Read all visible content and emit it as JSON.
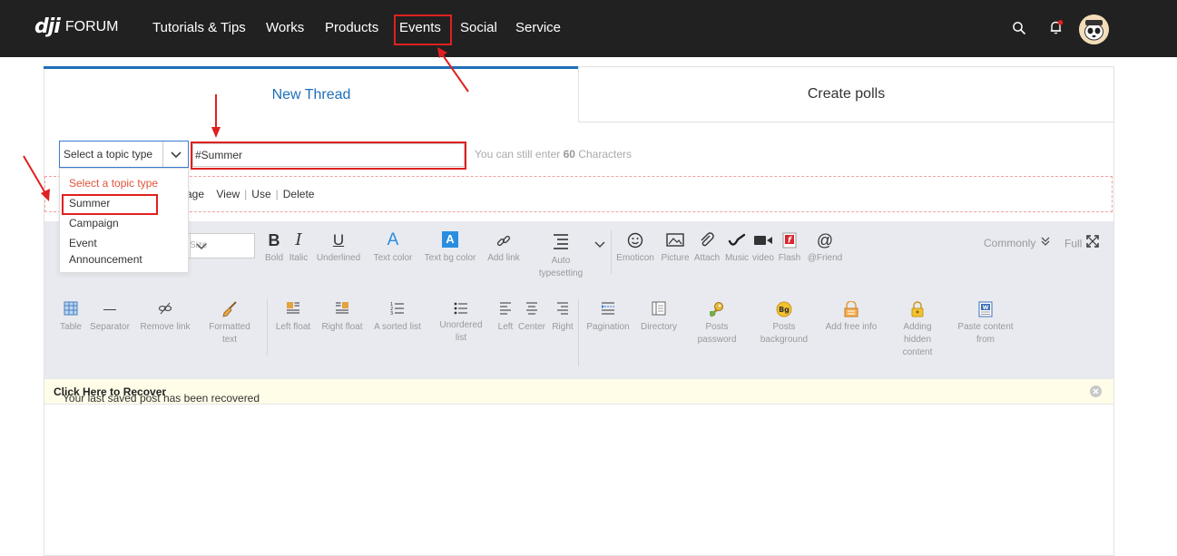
{
  "header": {
    "logo_mark": "dji",
    "logo_text": "FORUM",
    "nav": [
      "Tutorials & Tips",
      "Works",
      "Products",
      "Events",
      "Social",
      "Service"
    ],
    "search_icon": "search-icon",
    "bell_icon": "bell-icon",
    "notification_dot_color": "#e02020"
  },
  "tabs": {
    "new_thread": "New Thread",
    "create_polls": "Create polls"
  },
  "form": {
    "topic_select_value": "Select a topic type",
    "title_value": "#Summer",
    "char_hint_prefix": "You can still enter ",
    "char_hint_count": "60",
    "char_hint_suffix": " Characters",
    "tag_actions": [
      "age",
      "View",
      "Use",
      "Delete"
    ]
  },
  "dropdown": {
    "options": [
      "Select a topic type",
      "Summer",
      "Campaign",
      "Event",
      "Announcement"
    ]
  },
  "toolbar": {
    "size_placeholder": "Size",
    "row1": [
      {
        "icon": "bold-icon",
        "glyph": "B",
        "label": "Bold"
      },
      {
        "icon": "italic-icon",
        "glyph": "I",
        "label": "Italic"
      },
      {
        "icon": "underline-icon",
        "glyph": "U",
        "label": "Underlined"
      },
      {
        "icon": "text-color-icon",
        "glyph": "A",
        "label": "Text color"
      },
      {
        "icon": "text-bg-color-icon",
        "glyph": "A",
        "label": "Text bg color"
      },
      {
        "icon": "link-icon",
        "glyph": "🔗",
        "label": "Add link"
      },
      {
        "icon": "auto-typesetting-icon",
        "glyph": "≡",
        "label": "Auto typesetting"
      },
      {
        "icon": "emoticon-icon",
        "glyph": "☺",
        "label": "Emoticon"
      },
      {
        "icon": "picture-icon",
        "glyph": "▣",
        "label": "Picture"
      },
      {
        "icon": "attach-icon",
        "glyph": "📎",
        "label": "Attach"
      },
      {
        "icon": "music-icon",
        "glyph": "♪",
        "label": "Music"
      },
      {
        "icon": "video-icon",
        "glyph": "■",
        "label": "video"
      },
      {
        "icon": "flash-icon",
        "glyph": "f",
        "label": "Flash"
      },
      {
        "icon": "at-friend-icon",
        "glyph": "@",
        "label": "@Friend"
      }
    ],
    "commonly": "Commonly",
    "full": "Full",
    "row2": [
      {
        "icon": "table-icon",
        "glyph": "▦",
        "label": "Table"
      },
      {
        "icon": "separator-icon",
        "glyph": "—",
        "label": "Separator"
      },
      {
        "icon": "remove-link-icon",
        "glyph": "⛓",
        "label": "Remove link"
      },
      {
        "icon": "formatted-text-icon",
        "glyph": "🧹",
        "label": "Formatted text"
      },
      {
        "icon": "left-float-icon",
        "glyph": "▤",
        "label": "Left float"
      },
      {
        "icon": "right-float-icon",
        "glyph": "▤",
        "label": "Right float"
      },
      {
        "icon": "sorted-list-icon",
        "glyph": "☰",
        "label": "A sorted list"
      },
      {
        "icon": "unordered-list-icon",
        "glyph": "☰",
        "label": "Unordered list"
      },
      {
        "icon": "align-left-icon",
        "glyph": "≡",
        "label": "Left"
      },
      {
        "icon": "align-center-icon",
        "glyph": "≡",
        "label": "Center"
      },
      {
        "icon": "align-right-icon",
        "glyph": "≡",
        "label": "Right"
      },
      {
        "icon": "pagination-icon",
        "glyph": "☰",
        "label": "Pagination"
      },
      {
        "icon": "directory-icon",
        "glyph": "▥",
        "label": "Directory"
      },
      {
        "icon": "posts-password-icon",
        "glyph": "🔑",
        "label": "Posts password"
      },
      {
        "icon": "posts-background-icon",
        "glyph": "Bg",
        "label": "Posts background"
      },
      {
        "icon": "add-free-info-icon",
        "glyph": "▦",
        "label": "Add free info"
      },
      {
        "icon": "adding-hidden-content-icon",
        "glyph": "🔒",
        "label": "Adding hidden content"
      },
      {
        "icon": "paste-content-icon",
        "glyph": "W",
        "label": "Paste content from"
      }
    ]
  },
  "notice": {
    "text": "Your last saved post has been recovered ",
    "link": "Click Here to Recover"
  },
  "colors": {
    "accent": "#1f6fb8",
    "highlight": "#e02020",
    "topbar": "#212121"
  }
}
